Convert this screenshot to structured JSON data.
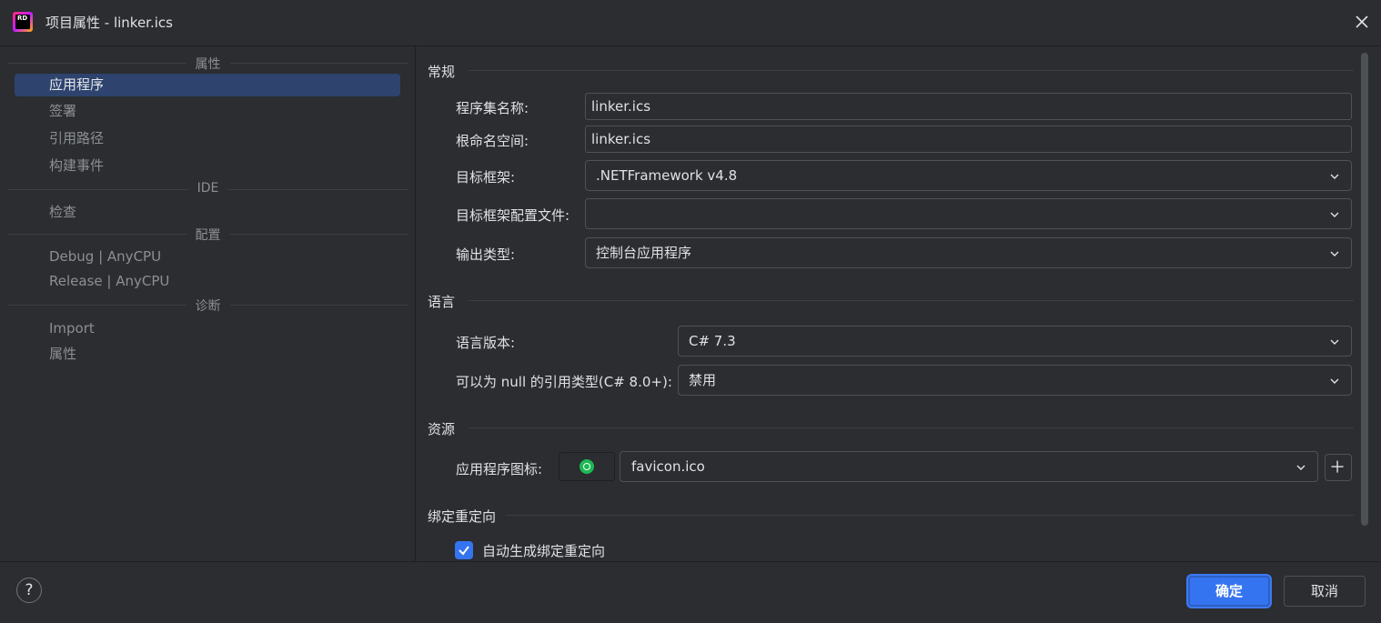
{
  "window": {
    "title": "项目属性 - linker.ics",
    "app_icon_text": "RD"
  },
  "nav": {
    "sections": [
      {
        "title": "属性",
        "items": [
          "应用程序",
          "签署",
          "引用路径",
          "构建事件"
        ]
      },
      {
        "title": "IDE",
        "items": [
          "检查"
        ]
      },
      {
        "title": "配置",
        "items": [
          "Debug | AnyCPU",
          "Release | AnyCPU"
        ]
      },
      {
        "title": "诊断",
        "items": [
          "Import",
          "属性"
        ]
      }
    ],
    "selected": "应用程序"
  },
  "general": {
    "title": "常规",
    "assembly_name_label": "程序集名称:",
    "assembly_name_value": "linker.ics",
    "root_namespace_label": "根命名空间:",
    "root_namespace_value": "linker.ics",
    "target_framework_label": "目标框架:",
    "target_framework_value": ".NETFramework v4.8",
    "target_framework_config_label": "目标框架配置文件:",
    "target_framework_config_value": "",
    "output_type_label": "输出类型:",
    "output_type_value": "控制台应用程序"
  },
  "language": {
    "title": "语言",
    "version_label": "语言版本:",
    "version_value": "C# 7.3",
    "nullable_label": "可以为 null 的引用类型(C# 8.0+):",
    "nullable_value": "禁用"
  },
  "resources": {
    "title": "资源",
    "app_icon_label": "应用程序图标:",
    "app_icon_value": "favicon.ico"
  },
  "binding_redirect": {
    "title": "绑定重定向",
    "auto_generate_label": "自动生成绑定重定向",
    "auto_generate_checked": true
  },
  "footer": {
    "help": "?",
    "ok": "确定",
    "cancel": "取消"
  },
  "colors": {
    "accent": "#3574f0",
    "selected_nav": "#2e436e",
    "background": "#2b2d30"
  }
}
